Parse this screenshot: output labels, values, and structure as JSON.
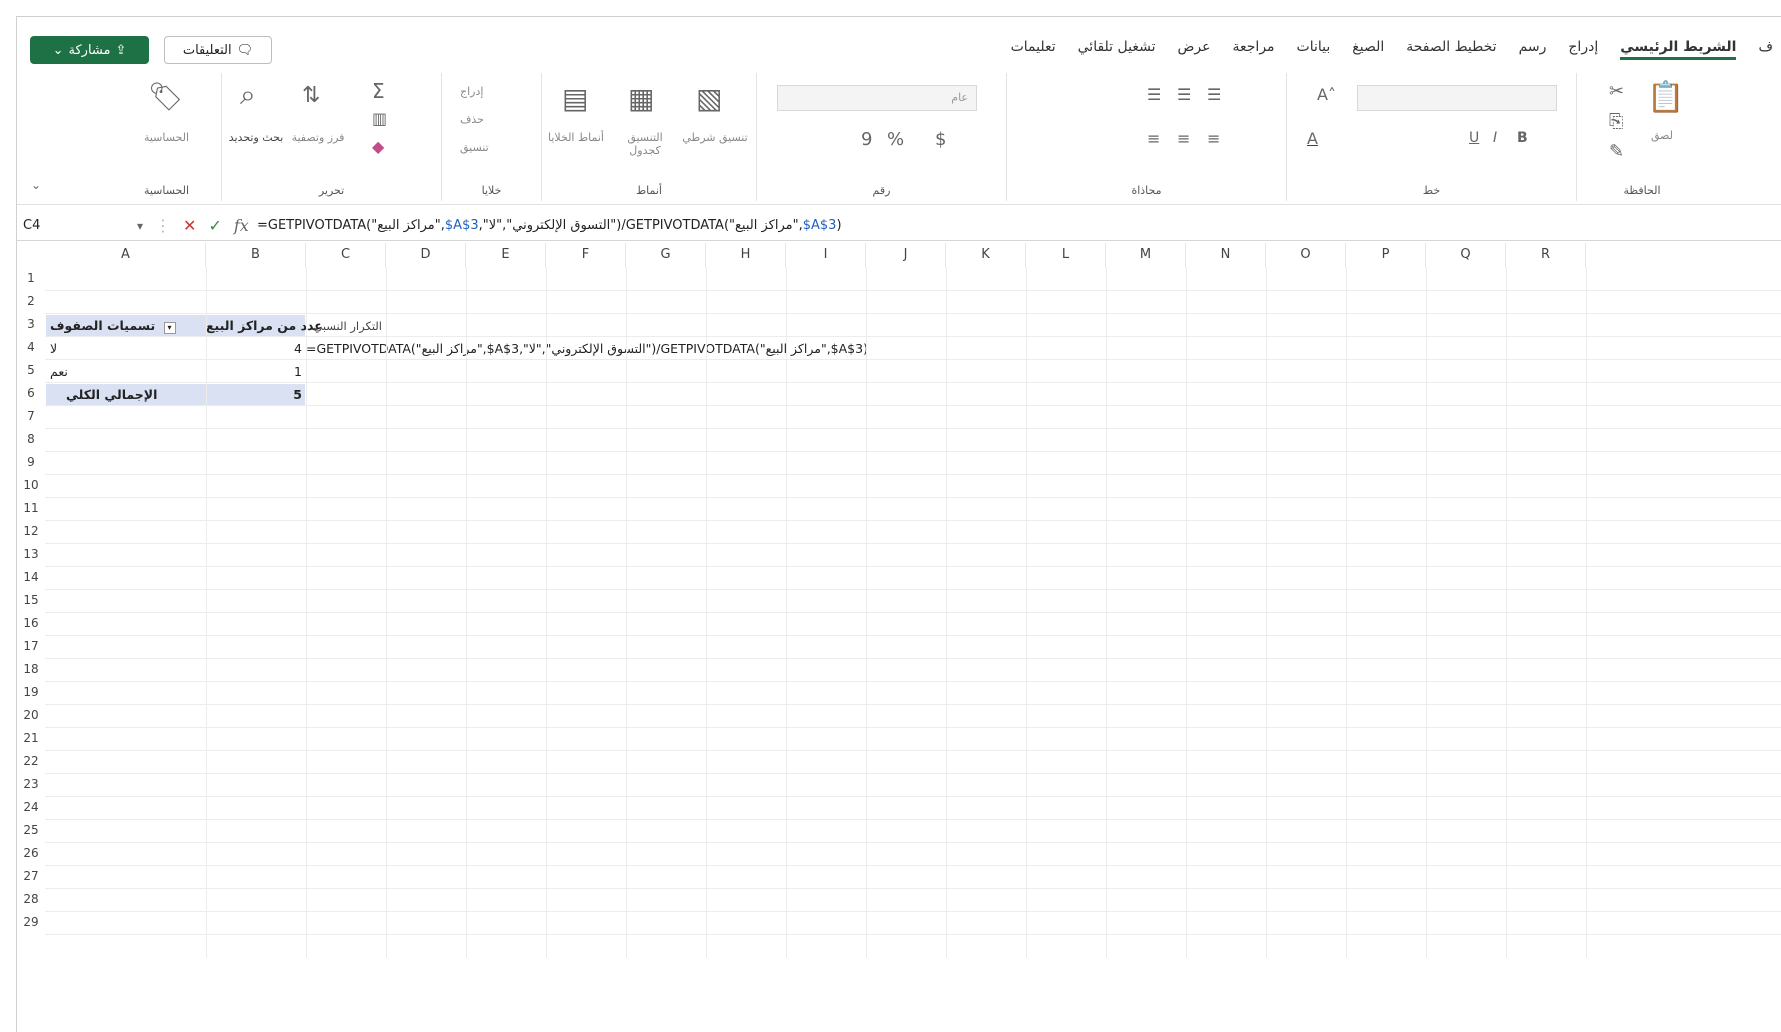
{
  "header": {
    "share_label": "مشاركة",
    "comments_label": "التعليقات",
    "tabs": [
      {
        "label": "ف"
      },
      {
        "label": "الشريط الرئيسي"
      },
      {
        "label": "إدراج"
      },
      {
        "label": "رسم"
      },
      {
        "label": "تخطيط الصفحة"
      },
      {
        "label": "الصيغ"
      },
      {
        "label": "بيانات"
      },
      {
        "label": "مراجعة"
      },
      {
        "label": "عرض"
      },
      {
        "label": "تشغيل تلقائي"
      },
      {
        "label": "تعليمات"
      }
    ]
  },
  "ribbon": {
    "groups": {
      "clipboard": "الحافظة",
      "font": "خط",
      "alignment": "محاذاة",
      "number": "رقم",
      "styles": "أنماط",
      "cells": "خلايا",
      "editing": "تحرير",
      "sensitivity": "الحساسية"
    },
    "buttons": {
      "paste": "لصق",
      "number_format": "عام",
      "conditional_formatting": "تنسيق شرطي",
      "format_as_table": "التنسيق كجدول",
      "cell_styles": "أنماط الخلايا",
      "insert": "إدراج",
      "delete": "حذف",
      "format": "تنسيق",
      "sort_filter": "فرز وتصفية",
      "find_select": "بحث وتحديد",
      "sensitivity": "الحساسية",
      "currency": "$",
      "percent": "%",
      "comma": "9"
    }
  },
  "formula_bar": {
    "name_box": "C4",
    "fx": "fx",
    "formula_pre": "=GETPIVOTDATA(\"مراكز البيع\",",
    "formula_ref1": "$A$3",
    "formula_mid": ",\"التسوق الإلكتروني\",\"لا\")/GETPIVOTDATA(\"مراكز البيع\",",
    "formula_ref2": "$A$3",
    "formula_post": ")"
  },
  "columns": [
    "A",
    "B",
    "C",
    "D",
    "E",
    "F",
    "G",
    "H",
    "I",
    "J",
    "K",
    "L",
    "M",
    "N",
    "O",
    "P",
    "Q",
    "R"
  ],
  "rows": [
    "1",
    "2",
    "3",
    "4",
    "5",
    "6",
    "7",
    "8",
    "9",
    "10",
    "11",
    "12",
    "13",
    "14",
    "15",
    "16",
    "17",
    "18",
    "19",
    "20",
    "21",
    "22",
    "23",
    "24",
    "25",
    "26",
    "27",
    "28",
    "29"
  ],
  "pivot": {
    "row_labels_header": "تسميات الصفوف",
    "count_header": "عدد من مراكز البيع",
    "rel_freq_header": "التكرار النسبي",
    "row1_label": "لا",
    "row1_value": "4",
    "row2_label": "نعم",
    "row2_value": "1",
    "total_label": "الإجمالي الكلي",
    "total_value": "5",
    "c4_formula": "=GETPIVOTDATA(\"مراكز البيع\",$A$3,\"التسوق الإلكتروني\",\"لا\")/GETPIVOTDATA(\"مراكز البيع\",$A$3)"
  }
}
